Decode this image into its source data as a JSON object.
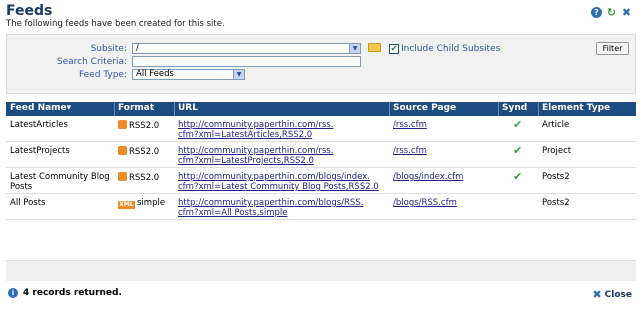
{
  "header": {
    "title": "Feeds",
    "subtitle": "The following feeds have been created for this site.",
    "icons": [
      "help-icon",
      "refresh-icon",
      "close-icon"
    ]
  },
  "filters": {
    "subsite_label": "Subsite:",
    "subsite_value": "/",
    "include_child_label": "Include Child Subsites",
    "include_child_checked": true,
    "search_label": "Search Criteria:",
    "search_value": "",
    "feed_type_label": "Feed Type:",
    "feed_type_value": "All Feeds",
    "filter_button": "Filter"
  },
  "grid": {
    "columns": [
      "Feed Name▾",
      "Format",
      "URL",
      "Source Page",
      "Synd",
      "Element Type"
    ],
    "rows": [
      {
        "name_1": "LatestArticles",
        "name_2": "",
        "format_icon": "rss-icon",
        "format": "RSS2.0",
        "url_1": "http://community.paperthin.com/rss.",
        "url_2": "cfm?xml=LatestArticles,RSS2.0",
        "source": "/rss.cfm",
        "synd": true,
        "element_type": "Article"
      },
      {
        "name_1": "LatestProjects",
        "name_2": "",
        "format_icon": "rss-icon",
        "format": "RSS2.0",
        "url_1": "http://community.paperthin.com/rss.",
        "url_2": "cfm?xml=LatestProjects,RSS2.0",
        "source": "/rss.cfm",
        "synd": true,
        "element_type": "Project"
      },
      {
        "name_1": "Latest Community Blog",
        "name_2": "Posts",
        "format_icon": "rss-icon",
        "format": "RSS2.0",
        "url_1": "http://community.paperthin.com/blogs/index.",
        "url_2": "cfm?xml=Latest Community Blog Posts,RSS2.0",
        "source": "/blogs/index.cfm",
        "synd": true,
        "element_type": "Posts2"
      },
      {
        "name_1": "All Posts",
        "name_2": "",
        "format_icon": "xml-icon",
        "format": "simple",
        "url_1": "http://community.paperthin.com/blogs/RSS.",
        "url_2": "cfm?xml=All Posts,simple",
        "source": "/blogs/RSS.cfm",
        "synd": false,
        "element_type": "Posts2"
      }
    ]
  },
  "footer": {
    "status": "4 records returned.",
    "close_label": "Close"
  },
  "icon_text": {
    "help": "?",
    "refresh": "↻",
    "close": "✖",
    "arrow": "▼",
    "check": "✔",
    "info": "i",
    "xml": "XML"
  }
}
